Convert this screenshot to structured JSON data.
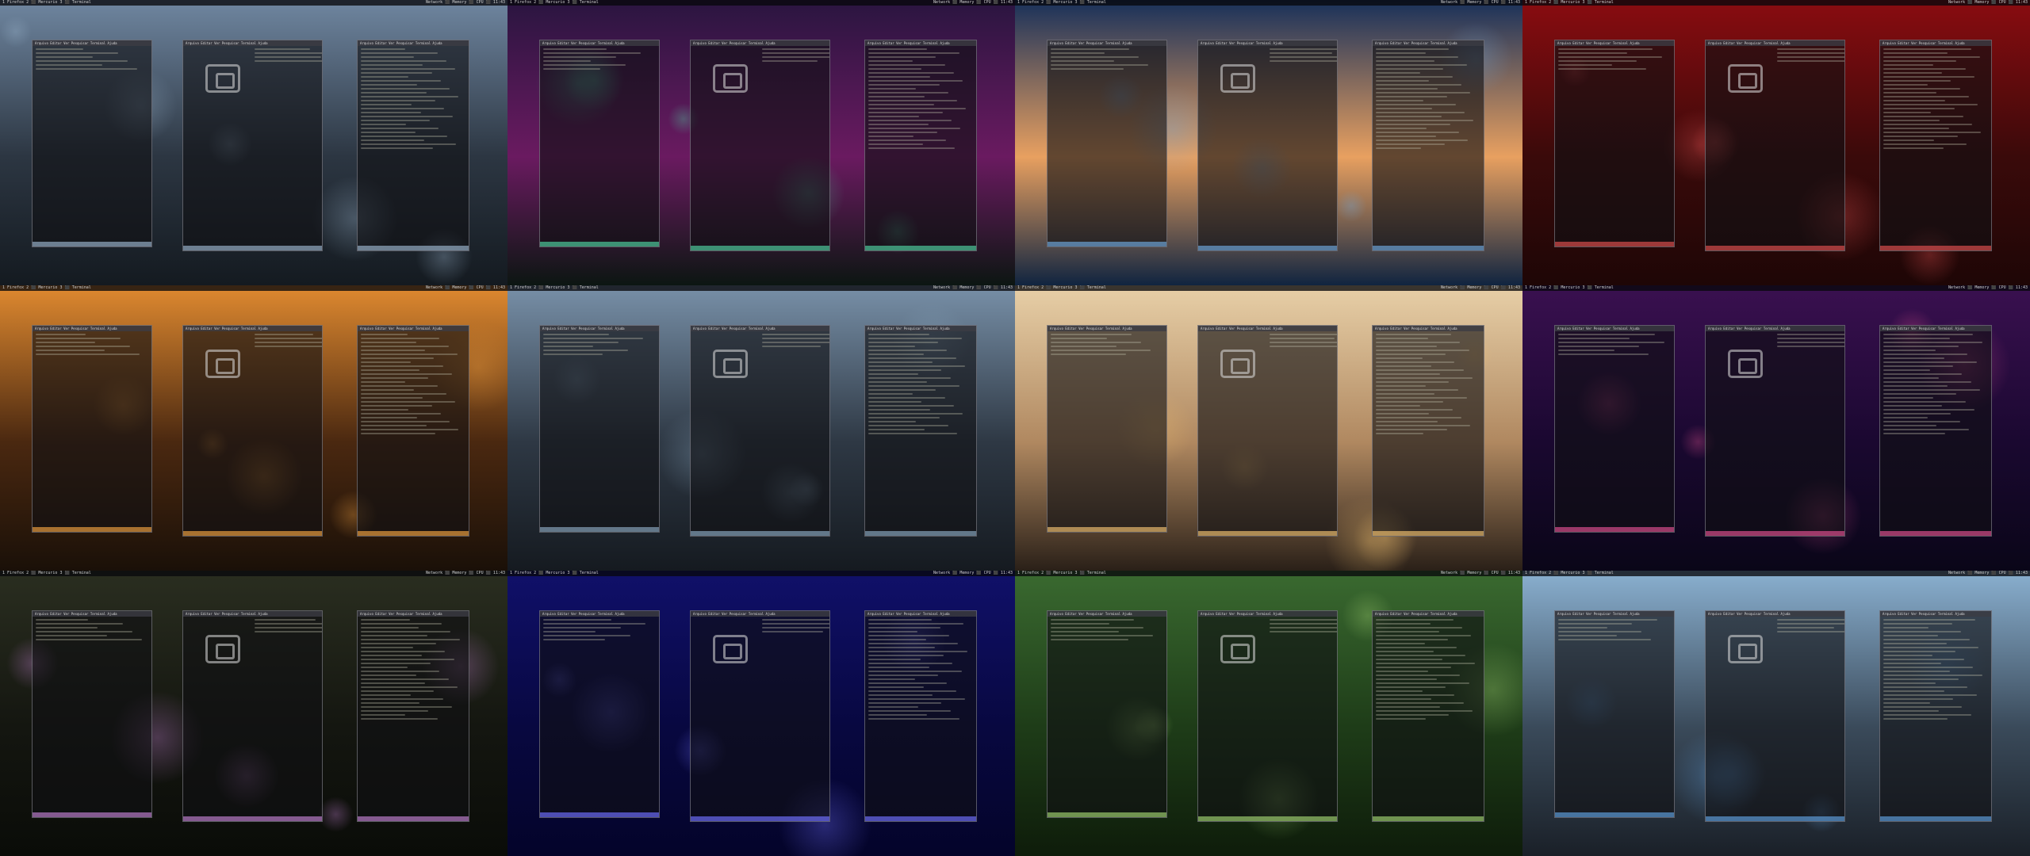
{
  "topbar": {
    "left_text": "1 Firefox 2 ⬛ Mercurio 3 ⬛ Terminal",
    "right_text": "Network ⬛ Memory ⬛ CPU ⬛ 11:43"
  },
  "window_titles": {
    "editor": "Arquivo Editar Ver Pesquisar Terminal Ajuda",
    "fetch": "Arquivo Editar Ver Pesquisar Terminal Ajuda",
    "files": "Arquivo Editar Ver Pesquisar Terminal Ajuda"
  },
  "tiles": [
    {
      "theme": "mountain-river",
      "bg": [
        "#6f86a0",
        "#2c3642",
        "#141a20"
      ],
      "accent": "#9ab4cc"
    },
    {
      "theme": "aurora",
      "bg": [
        "#2a1540",
        "#6a1a60",
        "#0c1612"
      ],
      "accent": "#4fd0a0"
    },
    {
      "theme": "lake-sunset",
      "bg": [
        "#18305a",
        "#e8a060",
        "#102440"
      ],
      "accent": "#6fa8dc"
    },
    {
      "theme": "red-tree",
      "bg": [
        "#8a0c10",
        "#3a0a0a",
        "#1e0606"
      ],
      "accent": "#e05050"
    },
    {
      "theme": "autumn-forest",
      "bg": [
        "#e08a30",
        "#4a2810",
        "#1a1008"
      ],
      "accent": "#f0a040"
    },
    {
      "theme": "mountain-river-2",
      "bg": [
        "#7890a8",
        "#2e3844",
        "#151a20"
      ],
      "accent": "#8aa8c0"
    },
    {
      "theme": "desert-car",
      "bg": [
        "#e8d0a8",
        "#b08860",
        "#2a2018"
      ],
      "accent": "#f0c070"
    },
    {
      "theme": "purple-nebula",
      "bg": [
        "#3a1050",
        "#1a0830",
        "#0a0618"
      ],
      "accent": "#e05090"
    },
    {
      "theme": "dark-leaves",
      "bg": [
        "#2a2e20",
        "#141610",
        "#0a0c08"
      ],
      "accent": "#c080d0"
    },
    {
      "theme": "blue-bubbles",
      "bg": [
        "#10106a",
        "#080840",
        "#04042a"
      ],
      "accent": "#7070ff"
    },
    {
      "theme": "green-forest",
      "bg": [
        "#3a6a30",
        "#1e3c18",
        "#0e1c0a"
      ],
      "accent": "#a0d070"
    },
    {
      "theme": "blue-mountains",
      "bg": [
        "#8ab0d0",
        "#3a4a5a",
        "#1a2028"
      ],
      "accent": "#60a0e0"
    }
  ]
}
